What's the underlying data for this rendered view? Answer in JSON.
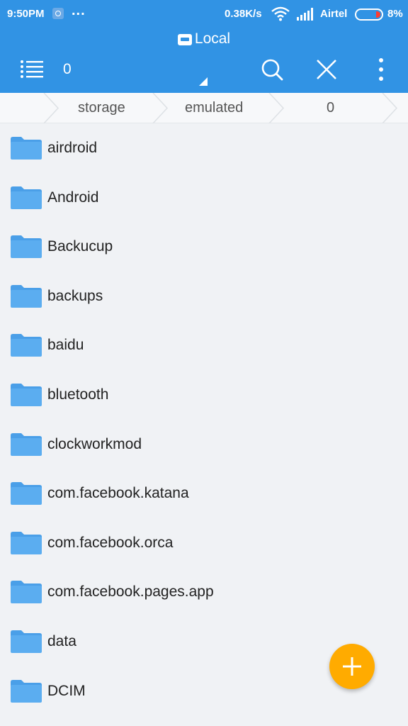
{
  "status_bar": {
    "time": "9:50PM",
    "dots": "...",
    "network_speed": "0.38K/s",
    "carrier": "Airtel",
    "battery_percent": "8%",
    "battery_level": 0.08
  },
  "toolbar": {
    "title": "Local",
    "path_count": "0",
    "icons": [
      "menu-icon",
      "search-icon",
      "close-icon",
      "more-vertical-icon"
    ]
  },
  "breadcrumb": {
    "items": [
      "storage",
      "emulated",
      "0"
    ]
  },
  "files": [
    {
      "name": "airdroid",
      "type": "folder"
    },
    {
      "name": "Android",
      "type": "folder"
    },
    {
      "name": "Backucup",
      "type": "folder"
    },
    {
      "name": "backups",
      "type": "folder"
    },
    {
      "name": "baidu",
      "type": "folder"
    },
    {
      "name": "bluetooth",
      "type": "folder"
    },
    {
      "name": "clockworkmod",
      "type": "folder"
    },
    {
      "name": "com.facebook.katana",
      "type": "folder"
    },
    {
      "name": "com.facebook.orca",
      "type": "folder"
    },
    {
      "name": "com.facebook.pages.app",
      "type": "folder"
    },
    {
      "name": "data",
      "type": "folder"
    },
    {
      "name": "DCIM",
      "type": "folder"
    }
  ],
  "colors": {
    "primary": "#3193e4",
    "folder": "#5badf0",
    "fab": "#ffab00"
  },
  "fab": {
    "icon": "plus-icon"
  }
}
